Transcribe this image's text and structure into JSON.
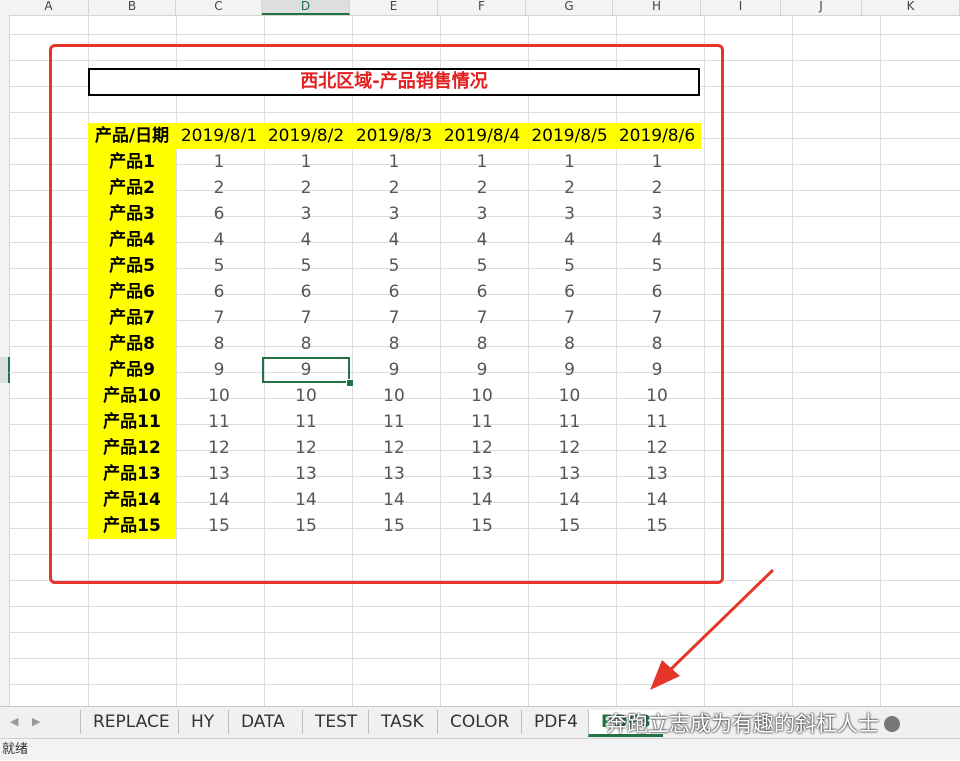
{
  "columns": [
    "A",
    "B",
    "C",
    "D",
    "E",
    "F",
    "G",
    "H",
    "I",
    "J",
    "K"
  ],
  "active_column": "D",
  "report": {
    "title": "西北区域-产品销售情况",
    "title_color": "#e31f1f",
    "header_label": "产品/日期",
    "dates": [
      "2019/8/1",
      "2019/8/2",
      "2019/8/3",
      "2019/8/4",
      "2019/8/5",
      "2019/8/6"
    ],
    "rows": [
      {
        "label": "产品1",
        "values": [
          "1",
          "1",
          "1",
          "1",
          "1",
          "1"
        ]
      },
      {
        "label": "产品2",
        "values": [
          "2",
          "2",
          "2",
          "2",
          "2",
          "2"
        ]
      },
      {
        "label": "产品3",
        "values": [
          "6",
          "3",
          "3",
          "3",
          "3",
          "3"
        ]
      },
      {
        "label": "产品4",
        "values": [
          "4",
          "4",
          "4",
          "4",
          "4",
          "4"
        ]
      },
      {
        "label": "产品5",
        "values": [
          "5",
          "5",
          "5",
          "5",
          "5",
          "5"
        ]
      },
      {
        "label": "产品6",
        "values": [
          "6",
          "6",
          "6",
          "6",
          "6",
          "6"
        ]
      },
      {
        "label": "产品7",
        "values": [
          "7",
          "7",
          "7",
          "7",
          "7",
          "7"
        ]
      },
      {
        "label": "产品8",
        "values": [
          "8",
          "8",
          "8",
          "8",
          "8",
          "8"
        ]
      },
      {
        "label": "产品9",
        "values": [
          "9",
          "9",
          "9",
          "9",
          "9",
          "9"
        ]
      },
      {
        "label": "产品10",
        "values": [
          "10",
          "10",
          "10",
          "10",
          "10",
          "10"
        ]
      },
      {
        "label": "产品11",
        "values": [
          "11",
          "11",
          "11",
          "11",
          "11",
          "11"
        ]
      },
      {
        "label": "产品12",
        "values": [
          "12",
          "12",
          "12",
          "12",
          "12",
          "12"
        ]
      },
      {
        "label": "产品13",
        "values": [
          "13",
          "13",
          "13",
          "13",
          "13",
          "13"
        ]
      },
      {
        "label": "产品14",
        "values": [
          "14",
          "14",
          "14",
          "14",
          "14",
          "14"
        ]
      },
      {
        "label": "产品15",
        "values": [
          "15",
          "15",
          "15",
          "15",
          "15",
          "15"
        ]
      }
    ],
    "header_fill": "#ffff00"
  },
  "selected_cell": "D11",
  "annotation_color": "#e53528",
  "sheet_tabs": [
    {
      "label": "REPLACE",
      "active": false
    },
    {
      "label": "HY",
      "active": false
    },
    {
      "label": "DATA",
      "active": false
    },
    {
      "label": "TEST",
      "active": false
    },
    {
      "label": "TASK",
      "active": false
    },
    {
      "label": "COLOR",
      "active": false
    },
    {
      "label": "PDF4",
      "active": false
    },
    {
      "label": "PDF3",
      "active": true
    }
  ],
  "watermark": "奔跑立志成为有趣的斜杠人士",
  "status": "就绪",
  "accent_color": "#217346"
}
